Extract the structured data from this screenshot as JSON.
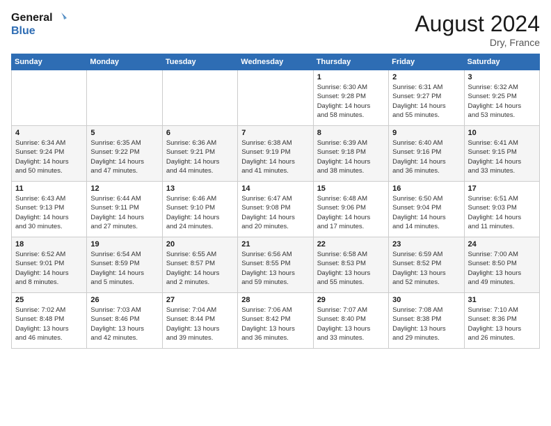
{
  "header": {
    "logo_line1": "General",
    "logo_line2": "Blue",
    "month": "August 2024",
    "location": "Dry, France"
  },
  "weekdays": [
    "Sunday",
    "Monday",
    "Tuesday",
    "Wednesday",
    "Thursday",
    "Friday",
    "Saturday"
  ],
  "weeks": [
    [
      {
        "day": "",
        "info": ""
      },
      {
        "day": "",
        "info": ""
      },
      {
        "day": "",
        "info": ""
      },
      {
        "day": "",
        "info": ""
      },
      {
        "day": "1",
        "info": "Sunrise: 6:30 AM\nSunset: 9:28 PM\nDaylight: 14 hours\nand 58 minutes."
      },
      {
        "day": "2",
        "info": "Sunrise: 6:31 AM\nSunset: 9:27 PM\nDaylight: 14 hours\nand 55 minutes."
      },
      {
        "day": "3",
        "info": "Sunrise: 6:32 AM\nSunset: 9:25 PM\nDaylight: 14 hours\nand 53 minutes."
      }
    ],
    [
      {
        "day": "4",
        "info": "Sunrise: 6:34 AM\nSunset: 9:24 PM\nDaylight: 14 hours\nand 50 minutes."
      },
      {
        "day": "5",
        "info": "Sunrise: 6:35 AM\nSunset: 9:22 PM\nDaylight: 14 hours\nand 47 minutes."
      },
      {
        "day": "6",
        "info": "Sunrise: 6:36 AM\nSunset: 9:21 PM\nDaylight: 14 hours\nand 44 minutes."
      },
      {
        "day": "7",
        "info": "Sunrise: 6:38 AM\nSunset: 9:19 PM\nDaylight: 14 hours\nand 41 minutes."
      },
      {
        "day": "8",
        "info": "Sunrise: 6:39 AM\nSunset: 9:18 PM\nDaylight: 14 hours\nand 38 minutes."
      },
      {
        "day": "9",
        "info": "Sunrise: 6:40 AM\nSunset: 9:16 PM\nDaylight: 14 hours\nand 36 minutes."
      },
      {
        "day": "10",
        "info": "Sunrise: 6:41 AM\nSunset: 9:15 PM\nDaylight: 14 hours\nand 33 minutes."
      }
    ],
    [
      {
        "day": "11",
        "info": "Sunrise: 6:43 AM\nSunset: 9:13 PM\nDaylight: 14 hours\nand 30 minutes."
      },
      {
        "day": "12",
        "info": "Sunrise: 6:44 AM\nSunset: 9:11 PM\nDaylight: 14 hours\nand 27 minutes."
      },
      {
        "day": "13",
        "info": "Sunrise: 6:46 AM\nSunset: 9:10 PM\nDaylight: 14 hours\nand 24 minutes."
      },
      {
        "day": "14",
        "info": "Sunrise: 6:47 AM\nSunset: 9:08 PM\nDaylight: 14 hours\nand 20 minutes."
      },
      {
        "day": "15",
        "info": "Sunrise: 6:48 AM\nSunset: 9:06 PM\nDaylight: 14 hours\nand 17 minutes."
      },
      {
        "day": "16",
        "info": "Sunrise: 6:50 AM\nSunset: 9:04 PM\nDaylight: 14 hours\nand 14 minutes."
      },
      {
        "day": "17",
        "info": "Sunrise: 6:51 AM\nSunset: 9:03 PM\nDaylight: 14 hours\nand 11 minutes."
      }
    ],
    [
      {
        "day": "18",
        "info": "Sunrise: 6:52 AM\nSunset: 9:01 PM\nDaylight: 14 hours\nand 8 minutes."
      },
      {
        "day": "19",
        "info": "Sunrise: 6:54 AM\nSunset: 8:59 PM\nDaylight: 14 hours\nand 5 minutes."
      },
      {
        "day": "20",
        "info": "Sunrise: 6:55 AM\nSunset: 8:57 PM\nDaylight: 14 hours\nand 2 minutes."
      },
      {
        "day": "21",
        "info": "Sunrise: 6:56 AM\nSunset: 8:55 PM\nDaylight: 13 hours\nand 59 minutes."
      },
      {
        "day": "22",
        "info": "Sunrise: 6:58 AM\nSunset: 8:53 PM\nDaylight: 13 hours\nand 55 minutes."
      },
      {
        "day": "23",
        "info": "Sunrise: 6:59 AM\nSunset: 8:52 PM\nDaylight: 13 hours\nand 52 minutes."
      },
      {
        "day": "24",
        "info": "Sunrise: 7:00 AM\nSunset: 8:50 PM\nDaylight: 13 hours\nand 49 minutes."
      }
    ],
    [
      {
        "day": "25",
        "info": "Sunrise: 7:02 AM\nSunset: 8:48 PM\nDaylight: 13 hours\nand 46 minutes."
      },
      {
        "day": "26",
        "info": "Sunrise: 7:03 AM\nSunset: 8:46 PM\nDaylight: 13 hours\nand 42 minutes."
      },
      {
        "day": "27",
        "info": "Sunrise: 7:04 AM\nSunset: 8:44 PM\nDaylight: 13 hours\nand 39 minutes."
      },
      {
        "day": "28",
        "info": "Sunrise: 7:06 AM\nSunset: 8:42 PM\nDaylight: 13 hours\nand 36 minutes."
      },
      {
        "day": "29",
        "info": "Sunrise: 7:07 AM\nSunset: 8:40 PM\nDaylight: 13 hours\nand 33 minutes."
      },
      {
        "day": "30",
        "info": "Sunrise: 7:08 AM\nSunset: 8:38 PM\nDaylight: 13 hours\nand 29 minutes."
      },
      {
        "day": "31",
        "info": "Sunrise: 7:10 AM\nSunset: 8:36 PM\nDaylight: 13 hours\nand 26 minutes."
      }
    ]
  ]
}
